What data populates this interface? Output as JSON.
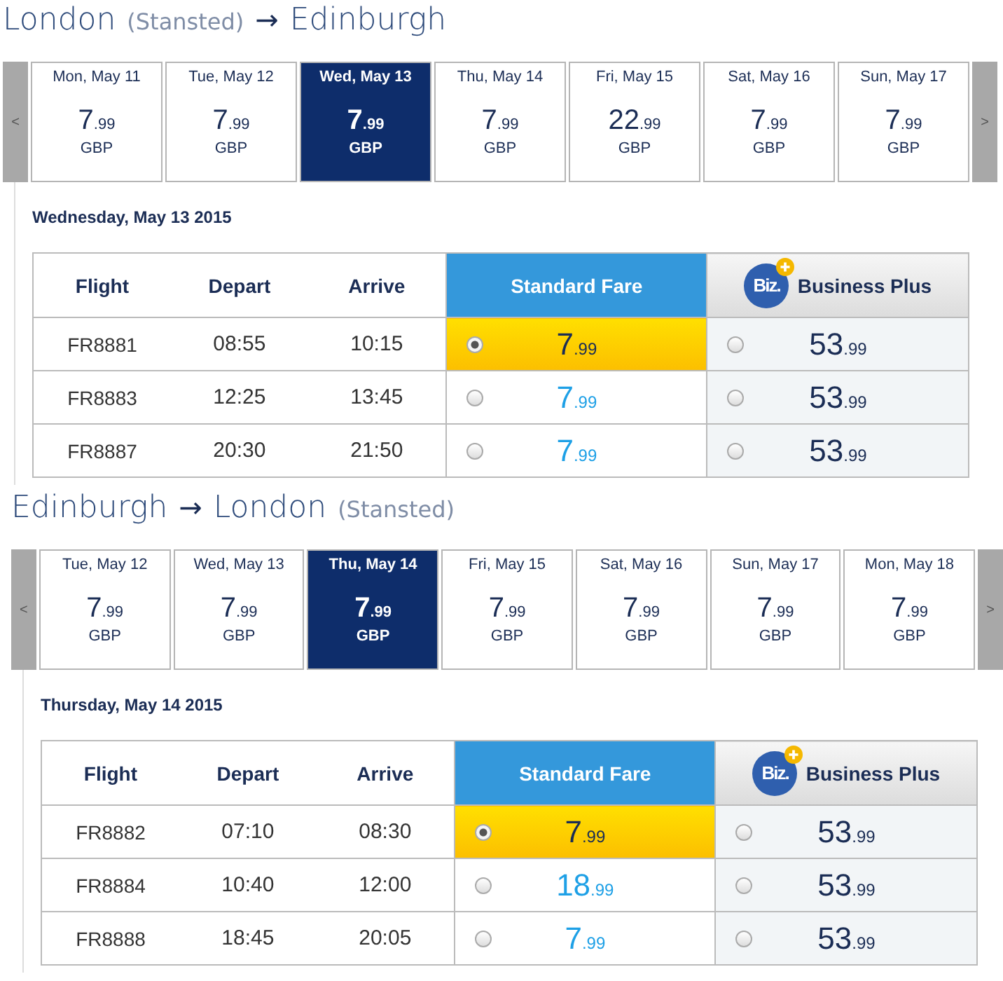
{
  "journeys": [
    {
      "title": [
        {
          "kind": "city",
          "text": "London"
        },
        {
          "kind": "note",
          "text": "(Stansted)"
        },
        {
          "kind": "arrow",
          "text": "→"
        },
        {
          "kind": "city",
          "text": "Edinburgh"
        }
      ],
      "prev": "<",
      "next": ">",
      "days": [
        {
          "label": "Mon, May 11",
          "main": "7",
          "fraction": ".99",
          "currency": "GBP",
          "selected": false
        },
        {
          "label": "Tue, May 12",
          "main": "7",
          "fraction": ".99",
          "currency": "GBP",
          "selected": false
        },
        {
          "label": "Wed, May 13",
          "main": "7",
          "fraction": ".99",
          "currency": "GBP",
          "selected": true
        },
        {
          "label": "Thu, May 14",
          "main": "7",
          "fraction": ".99",
          "currency": "GBP",
          "selected": false
        },
        {
          "label": "Fri, May 15",
          "main": "22",
          "fraction": ".99",
          "currency": "GBP",
          "selected": false
        },
        {
          "label": "Sat, May 16",
          "main": "7",
          "fraction": ".99",
          "currency": "GBP",
          "selected": false
        },
        {
          "label": "Sun, May 17",
          "main": "7",
          "fraction": ".99",
          "currency": "GBP",
          "selected": false
        }
      ],
      "date_heading": "Wednesday, May 13 2015",
      "columns": [
        "Flight",
        "Depart",
        "Arrive"
      ],
      "standard_header": "Standard Fare",
      "business_header": "Business Plus",
      "biz_logo": "Biz.",
      "flights": [
        {
          "flight": "FR8881",
          "depart": "08:55",
          "arrive": "10:15",
          "standard": {
            "main": "7",
            "fraction": ".99",
            "selected": true
          },
          "business": {
            "main": "53",
            "fraction": ".99",
            "selected": false
          }
        },
        {
          "flight": "FR8883",
          "depart": "12:25",
          "arrive": "13:45",
          "standard": {
            "main": "7",
            "fraction": ".99",
            "selected": false
          },
          "business": {
            "main": "53",
            "fraction": ".99",
            "selected": false
          }
        },
        {
          "flight": "FR8887",
          "depart": "20:30",
          "arrive": "21:50",
          "standard": {
            "main": "7",
            "fraction": ".99",
            "selected": false
          },
          "business": {
            "main": "53",
            "fraction": ".99",
            "selected": false
          }
        }
      ]
    },
    {
      "title": [
        {
          "kind": "city",
          "text": "Edinburgh"
        },
        {
          "kind": "arrow",
          "text": "→"
        },
        {
          "kind": "city",
          "text": "London"
        },
        {
          "kind": "note",
          "text": "(Stansted)"
        }
      ],
      "prev": "<",
      "next": ">",
      "days": [
        {
          "label": "Tue, May 12",
          "main": "7",
          "fraction": ".99",
          "currency": "GBP",
          "selected": false
        },
        {
          "label": "Wed, May 13",
          "main": "7",
          "fraction": ".99",
          "currency": "GBP",
          "selected": false
        },
        {
          "label": "Thu, May 14",
          "main": "7",
          "fraction": ".99",
          "currency": "GBP",
          "selected": true
        },
        {
          "label": "Fri, May 15",
          "main": "7",
          "fraction": ".99",
          "currency": "GBP",
          "selected": false
        },
        {
          "label": "Sat, May 16",
          "main": "7",
          "fraction": ".99",
          "currency": "GBP",
          "selected": false
        },
        {
          "label": "Sun, May 17",
          "main": "7",
          "fraction": ".99",
          "currency": "GBP",
          "selected": false
        },
        {
          "label": "Mon, May 18",
          "main": "7",
          "fraction": ".99",
          "currency": "GBP",
          "selected": false
        }
      ],
      "date_heading": "Thursday, May 14 2015",
      "columns": [
        "Flight",
        "Depart",
        "Arrive"
      ],
      "standard_header": "Standard Fare",
      "business_header": "Business Plus",
      "biz_logo": "Biz.",
      "flights": [
        {
          "flight": "FR8882",
          "depart": "07:10",
          "arrive": "08:30",
          "standard": {
            "main": "7",
            "fraction": ".99",
            "selected": true
          },
          "business": {
            "main": "53",
            "fraction": ".99",
            "selected": false
          }
        },
        {
          "flight": "FR8884",
          "depart": "10:40",
          "arrive": "12:00",
          "standard": {
            "main": "18",
            "fraction": ".99",
            "selected": false
          },
          "business": {
            "main": "53",
            "fraction": ".99",
            "selected": false
          }
        },
        {
          "flight": "FR8888",
          "depart": "18:45",
          "arrive": "20:05",
          "standard": {
            "main": "7",
            "fraction": ".99",
            "selected": false
          },
          "business": {
            "main": "53",
            "fraction": ".99",
            "selected": false
          }
        }
      ]
    }
  ]
}
